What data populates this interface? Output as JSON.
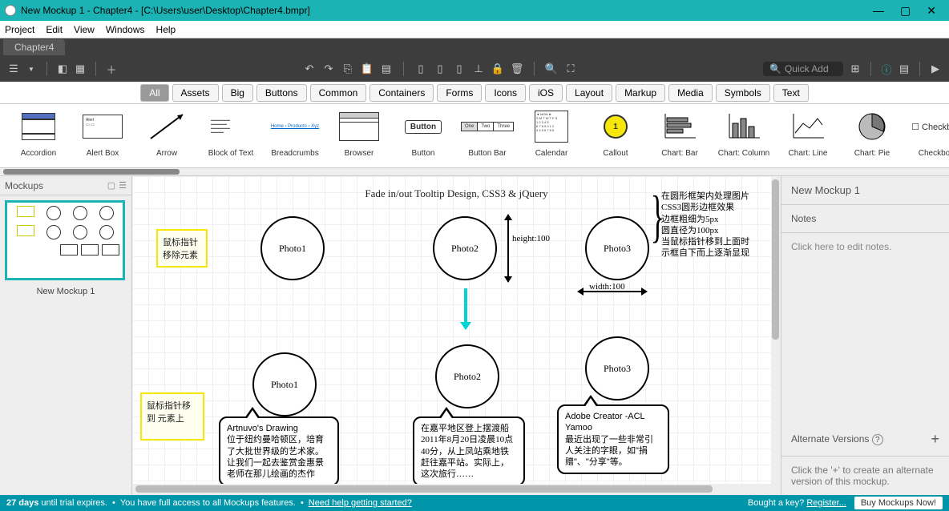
{
  "window": {
    "title": "New Mockup 1 - Chapter4 - [C:\\Users\\user\\Desktop\\Chapter4.bmpr]"
  },
  "menu": [
    "Project",
    "Edit",
    "View",
    "Windows",
    "Help"
  ],
  "tab": "Chapter4",
  "quick_add_placeholder": "Quick Add",
  "categories": [
    "All",
    "Assets",
    "Big",
    "Buttons",
    "Common",
    "Containers",
    "Forms",
    "Icons",
    "iOS",
    "Layout",
    "Markup",
    "Media",
    "Symbols",
    "Text"
  ],
  "active_category": "All",
  "components": [
    "Accordion",
    "Alert Box",
    "Arrow",
    "Block of Text",
    "Breadcrumbs",
    "Browser",
    "Button",
    "Button Bar",
    "Calendar",
    "Callout",
    "Chart: Bar",
    "Chart: Column",
    "Chart: Line",
    "Chart: Pie",
    "Checkbox"
  ],
  "checkbox_label": "Checkbox",
  "left": {
    "header": "Mockups",
    "thumb_label": "New Mockup 1"
  },
  "canvas": {
    "title": "Fade in/out Tooltip Design, CSS3 & jQuery",
    "note1": "鼠标指针\n移除元素",
    "note2": "鼠标指针移到\n元素上",
    "photo1": "Photo1",
    "photo2": "Photo2",
    "photo3": "Photo3",
    "height_label": "height:100",
    "width_label": "width:100",
    "annotation": "在圆形框架内处理图片\nCSS3圆形边框效果\n边框粗细为5px\n圆直径为100px\n当鼠标指针移到上面时\n示框自下而上逐渐显现",
    "speech1_title": "Artnuvo's Drawing",
    "speech1_body": "位于纽约曼哈顿区，培育了大批世界级的艺术家。让我们一起去鉴赏金惠景老师在那儿绘画的杰作",
    "speech2": "在嘉平地区登上摆渡船2011年8月20日凌晨10点40分，从上凤站乘地铁赶往嘉平站。实际上，这次旅行……",
    "speech3_title": "Adobe Creator -ACL Yamoo",
    "speech3_body": "最近出现了一些非常引人关注的字眼，如\"捐赠\"、\"分享\"等。"
  },
  "right": {
    "title": "New Mockup 1",
    "notes_header": "Notes",
    "notes_placeholder": "Click here to edit notes.",
    "alt_header": "Alternate Versions",
    "alt_hint": "Click the '+' to create an alternate version of this mockup."
  },
  "status": {
    "days": "27 days",
    "trial": " until trial expires.",
    "access": "You have full access to all Mockups features.",
    "help": "Need help getting started?",
    "bought": "Bought a key?",
    "register": "Register...",
    "buy": "Buy Mockups Now!"
  }
}
